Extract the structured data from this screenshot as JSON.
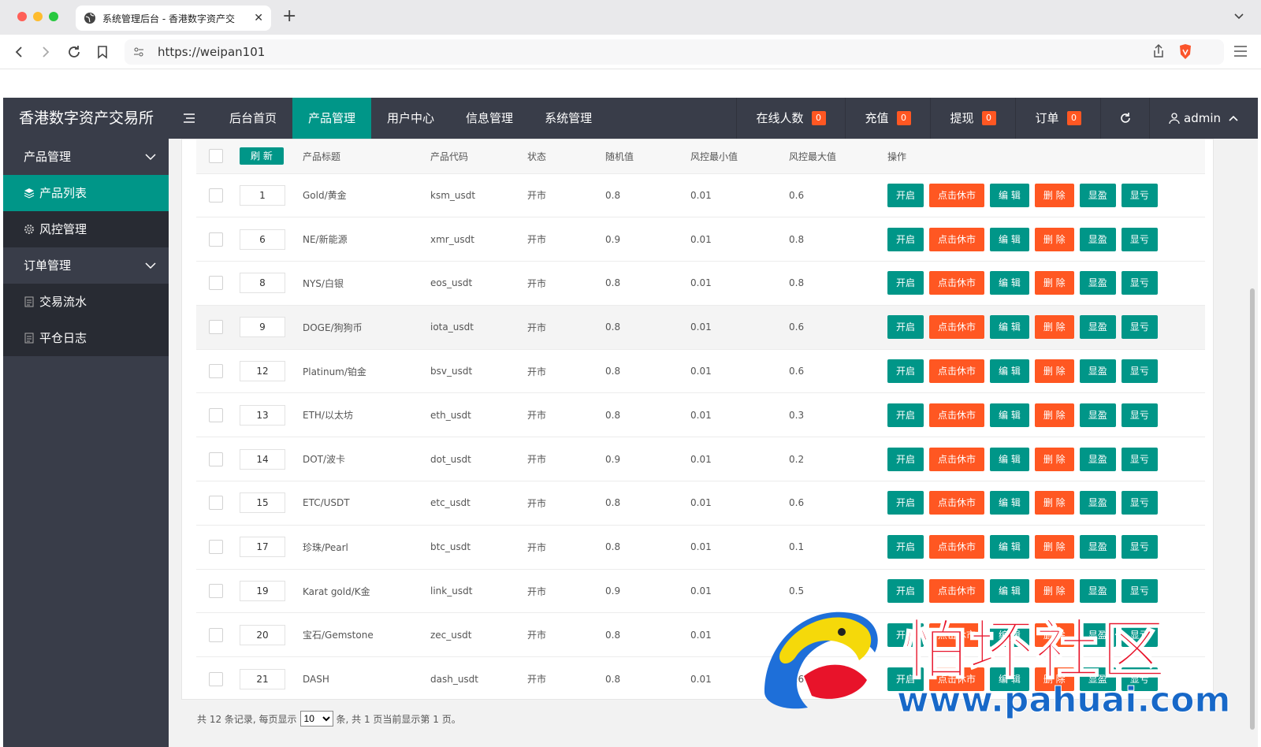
{
  "browser": {
    "tab_title": "系统管理后台 - 香港数字资产交",
    "url": "https://weipan101"
  },
  "header": {
    "brand": "香港数字资产交易所",
    "nav": [
      {
        "label": "后台首页",
        "active": false
      },
      {
        "label": "产品管理",
        "active": true
      },
      {
        "label": "用户中心",
        "active": false
      },
      {
        "label": "信息管理",
        "active": false
      },
      {
        "label": "系统管理",
        "active": false
      }
    ],
    "stats": [
      {
        "label": "在线人数",
        "count": "0"
      },
      {
        "label": "充值",
        "count": "0"
      },
      {
        "label": "提现",
        "count": "0"
      },
      {
        "label": "订单",
        "count": "0"
      }
    ],
    "user": "admin"
  },
  "sidebar": {
    "groups": [
      {
        "label": "产品管理",
        "items": [
          {
            "label": "产品列表",
            "active": true,
            "icon": "layers-icon"
          },
          {
            "label": "风控管理",
            "active": false,
            "icon": "gear-icon"
          }
        ]
      },
      {
        "label": "订单管理",
        "items": [
          {
            "label": "交易流水",
            "active": false,
            "icon": "document-icon"
          },
          {
            "label": "平仓日志",
            "active": false,
            "icon": "document-icon"
          }
        ]
      }
    ]
  },
  "table": {
    "refresh_label": "刷 新",
    "columns": [
      "产品标题",
      "产品代码",
      "状态",
      "随机值",
      "风控最小值",
      "风控最大值",
      "操作"
    ],
    "actions": [
      {
        "label": "开启",
        "color": "#009688"
      },
      {
        "label": "点击休市",
        "color": "#ff5722"
      },
      {
        "label": "编 辑",
        "color": "#009688"
      },
      {
        "label": "删 除",
        "color": "#ff5722"
      },
      {
        "label": "显盈",
        "color": "#009688"
      },
      {
        "label": "显亏",
        "color": "#009688"
      }
    ],
    "rows": [
      {
        "sort": "1",
        "title": "Gold/黄金",
        "code": "ksm_usdt",
        "status": "开市",
        "random": "0.8",
        "min": "0.01",
        "max": "0.6"
      },
      {
        "sort": "6",
        "title": "NE/新能源",
        "code": "xmr_usdt",
        "status": "开市",
        "random": "0.9",
        "min": "0.01",
        "max": "0.8"
      },
      {
        "sort": "8",
        "title": "NYS/白银",
        "code": "eos_usdt",
        "status": "开市",
        "random": "0.8",
        "min": "0.01",
        "max": "0.8"
      },
      {
        "sort": "9",
        "title": "DOGE/狗狗币",
        "code": "iota_usdt",
        "status": "开市",
        "random": "0.8",
        "min": "0.01",
        "max": "0.6"
      },
      {
        "sort": "12",
        "title": "Platinum/铂金",
        "code": "bsv_usdt",
        "status": "开市",
        "random": "0.8",
        "min": "0.01",
        "max": "0.6"
      },
      {
        "sort": "13",
        "title": "ETH/以太坊",
        "code": "eth_usdt",
        "status": "开市",
        "random": "0.8",
        "min": "0.01",
        "max": "0.3"
      },
      {
        "sort": "14",
        "title": "DOT/波卡",
        "code": "dot_usdt",
        "status": "开市",
        "random": "0.9",
        "min": "0.01",
        "max": "0.2"
      },
      {
        "sort": "15",
        "title": "ETC/USDT",
        "code": "etc_usdt",
        "status": "开市",
        "random": "0.8",
        "min": "0.01",
        "max": "0.6"
      },
      {
        "sort": "17",
        "title": "珍珠/Pearl",
        "code": "btc_usdt",
        "status": "开市",
        "random": "0.8",
        "min": "0.01",
        "max": "0.1"
      },
      {
        "sort": "19",
        "title": "Karat gold/K金",
        "code": "link_usdt",
        "status": "开市",
        "random": "0.9",
        "min": "0.01",
        "max": "0.5"
      },
      {
        "sort": "20",
        "title": "宝石/Gemstone",
        "code": "zec_usdt",
        "status": "开市",
        "random": "0.8",
        "min": "0.01",
        "max": "0.6"
      },
      {
        "sort": "21",
        "title": "DASH",
        "code": "dash_usdt",
        "status": "开市",
        "random": "0.8",
        "min": "0.01",
        "max": "0.6"
      }
    ]
  },
  "footer": {
    "prefix": "共 12 条记录,  每页显示",
    "page_size": "10",
    "suffix": "条,  共 1 页当前显示第 1 页。"
  },
  "watermark": {
    "title": "怕坏社区",
    "url": "www.pahuai.com"
  },
  "colors": {
    "header_bg": "#393d49",
    "accent": "#009688",
    "danger": "#ff5722"
  }
}
